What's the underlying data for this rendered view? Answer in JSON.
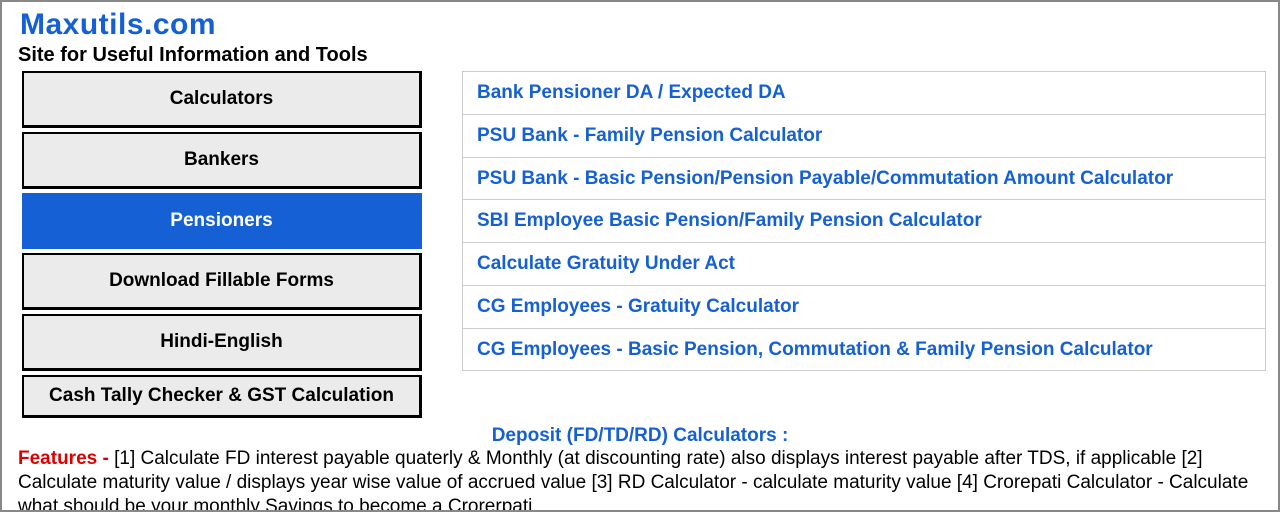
{
  "header": {
    "site_title": "Maxutils.com",
    "subtitle": "Site for Useful Information and Tools"
  },
  "nav": {
    "items": [
      {
        "label": "Calculators",
        "active": false
      },
      {
        "label": "Bankers",
        "active": false
      },
      {
        "label": "Pensioners",
        "active": true
      },
      {
        "label": "Download Fillable Forms",
        "active": false
      },
      {
        "label": "Hindi-English",
        "active": false
      },
      {
        "label": "Cash Tally Checker & GST Calculation",
        "active": false
      }
    ]
  },
  "links": {
    "items": [
      "Bank Pensioner DA / Expected DA",
      "PSU Bank - Family Pension Calculator",
      "PSU Bank - Basic Pension/Pension Payable/Commutation Amount Calculator",
      "SBI Employee Basic Pension/Family Pension Calculator",
      "Calculate Gratuity Under Act",
      "CG Employees - Gratuity Calculator",
      "CG Employees - Basic Pension, Commutation & Family Pension Calculator"
    ]
  },
  "footer": {
    "deposit_title": "Deposit (FD/TD/RD) Calculators :",
    "features_label": "Features - ",
    "features_text": "[1] Calculate FD interest payable quaterly & Monthly (at discounting rate) also displays interest payable after TDS, if applicable [2] Calculate maturity value / displays year wise value of accrued value [3] RD Calculator - calculate maturity value [4] Crorepati Calculator - Calculate what should be your monthly Savings to become a Crorerpati"
  }
}
